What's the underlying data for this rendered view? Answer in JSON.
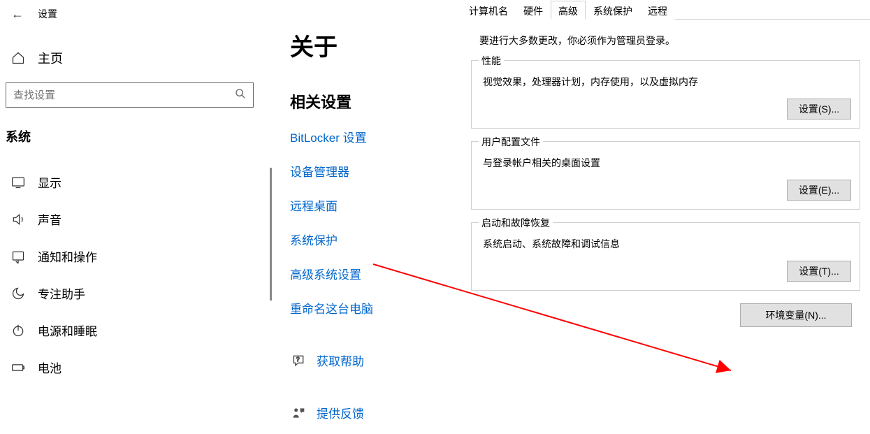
{
  "settings": {
    "title": "设置",
    "home": "主页",
    "search_placeholder": "查找设置",
    "category": "系统",
    "nav": [
      {
        "icon": "display",
        "label": "显示"
      },
      {
        "icon": "sound",
        "label": "声音"
      },
      {
        "icon": "notify",
        "label": "通知和操作"
      },
      {
        "icon": "focus",
        "label": "专注助手"
      },
      {
        "icon": "power",
        "label": "电源和睡眠"
      },
      {
        "icon": "battery",
        "label": "电池"
      }
    ]
  },
  "about": {
    "title": "关于",
    "related_title": "相关设置",
    "links": [
      "BitLocker 设置",
      "设备管理器",
      "远程桌面",
      "系统保护",
      "高级系统设置",
      "重命名这台电脑"
    ],
    "help": "获取帮助",
    "feedback": "提供反馈"
  },
  "dialog": {
    "tabs": [
      "计算机名",
      "硬件",
      "高级",
      "系统保护",
      "远程"
    ],
    "active_tab": 2,
    "admin_note": "要进行大多数更改，你必须作为管理员登录。",
    "groups": [
      {
        "legend": "性能",
        "desc": "视觉效果，处理器计划，内存使用，以及虚拟内存",
        "button": "设置(S)..."
      },
      {
        "legend": "用户配置文件",
        "desc": "与登录帐户相关的桌面设置",
        "button": "设置(E)..."
      },
      {
        "legend": "启动和故障恢复",
        "desc": "系统启动、系统故障和调试信息",
        "button": "设置(T)..."
      }
    ],
    "env_button": "环境变量(N)..."
  }
}
